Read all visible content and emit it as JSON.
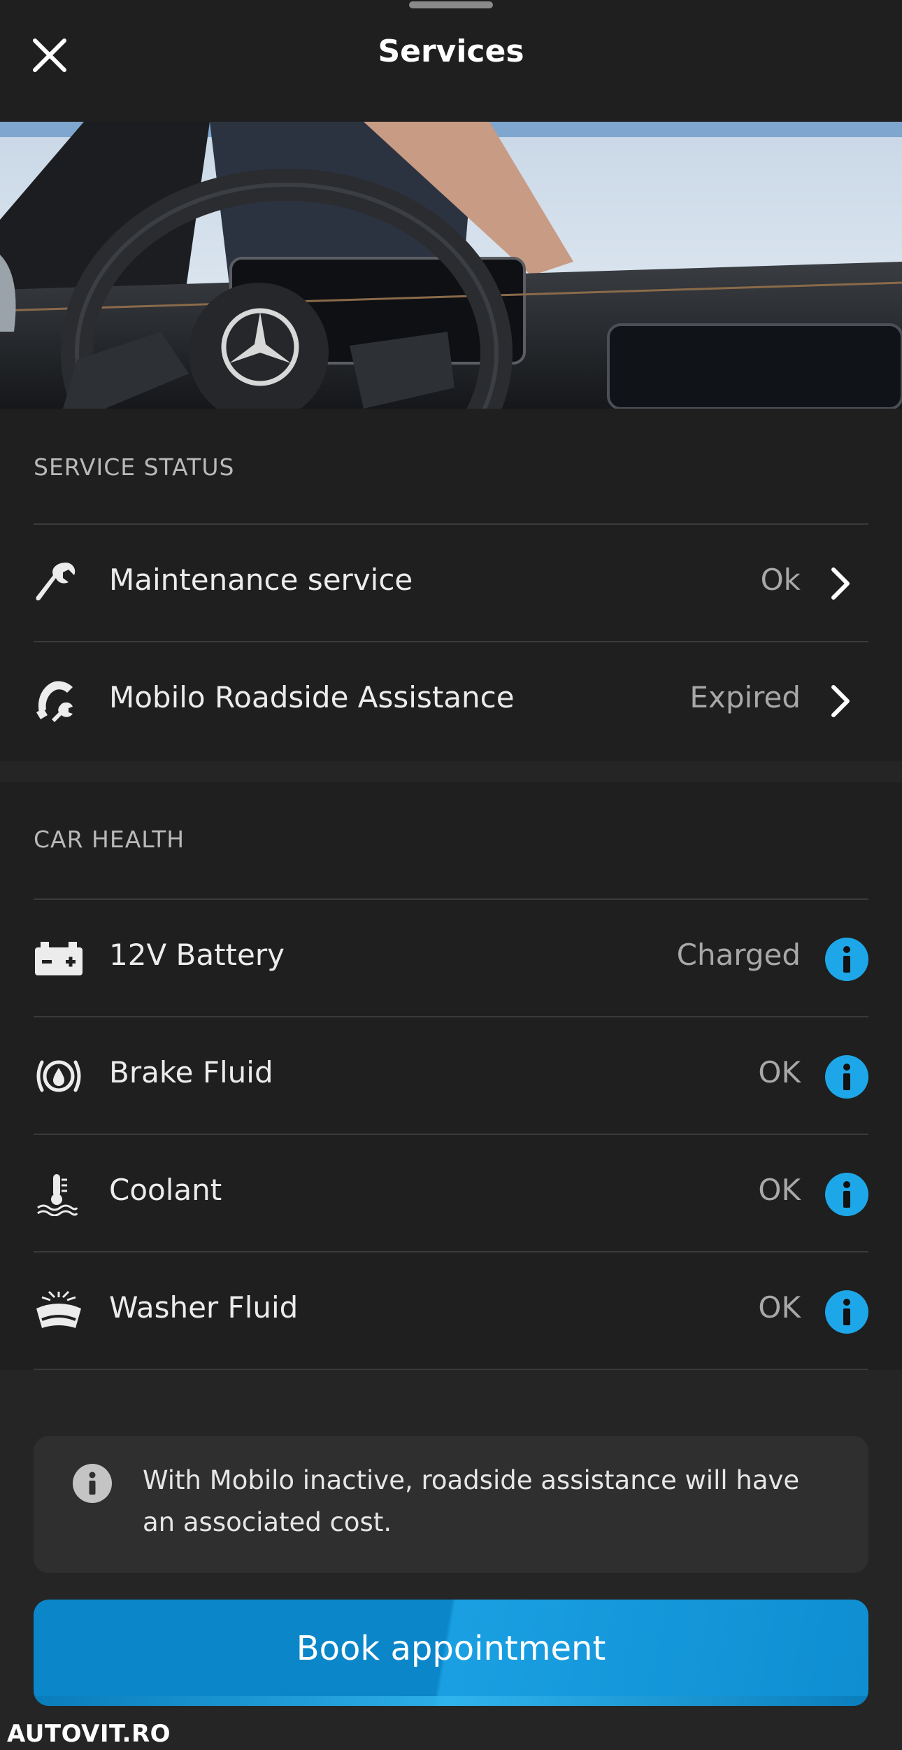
{
  "header": {
    "title": "Services"
  },
  "service_status": {
    "heading": "SERVICE STATUS",
    "items": [
      {
        "label": "Maintenance service",
        "status": "Ok",
        "icon": "wrench-icon"
      },
      {
        "label": "Mobilo Roadside Assistance",
        "status": "Expired",
        "icon": "roadside-phone-wrench-icon"
      }
    ]
  },
  "car_health": {
    "heading": "CAR HEALTH",
    "items": [
      {
        "label": "12V Battery",
        "status": "Charged",
        "icon": "battery-icon"
      },
      {
        "label": "Brake Fluid",
        "status": "OK",
        "icon": "brake-fluid-icon"
      },
      {
        "label": "Coolant",
        "status": "OK",
        "icon": "coolant-thermometer-icon"
      },
      {
        "label": "Washer Fluid",
        "status": "OK",
        "icon": "washer-fluid-icon"
      }
    ]
  },
  "notice": {
    "text": "With Mobilo inactive, roadside assistance will have an associated cost."
  },
  "actions": {
    "book_label": "Book appointment"
  },
  "watermark": "AUTOVIT.RO",
  "colors": {
    "accent": "#1ea7e8",
    "button": "#0a86c9",
    "background": "#1f1f1f"
  }
}
